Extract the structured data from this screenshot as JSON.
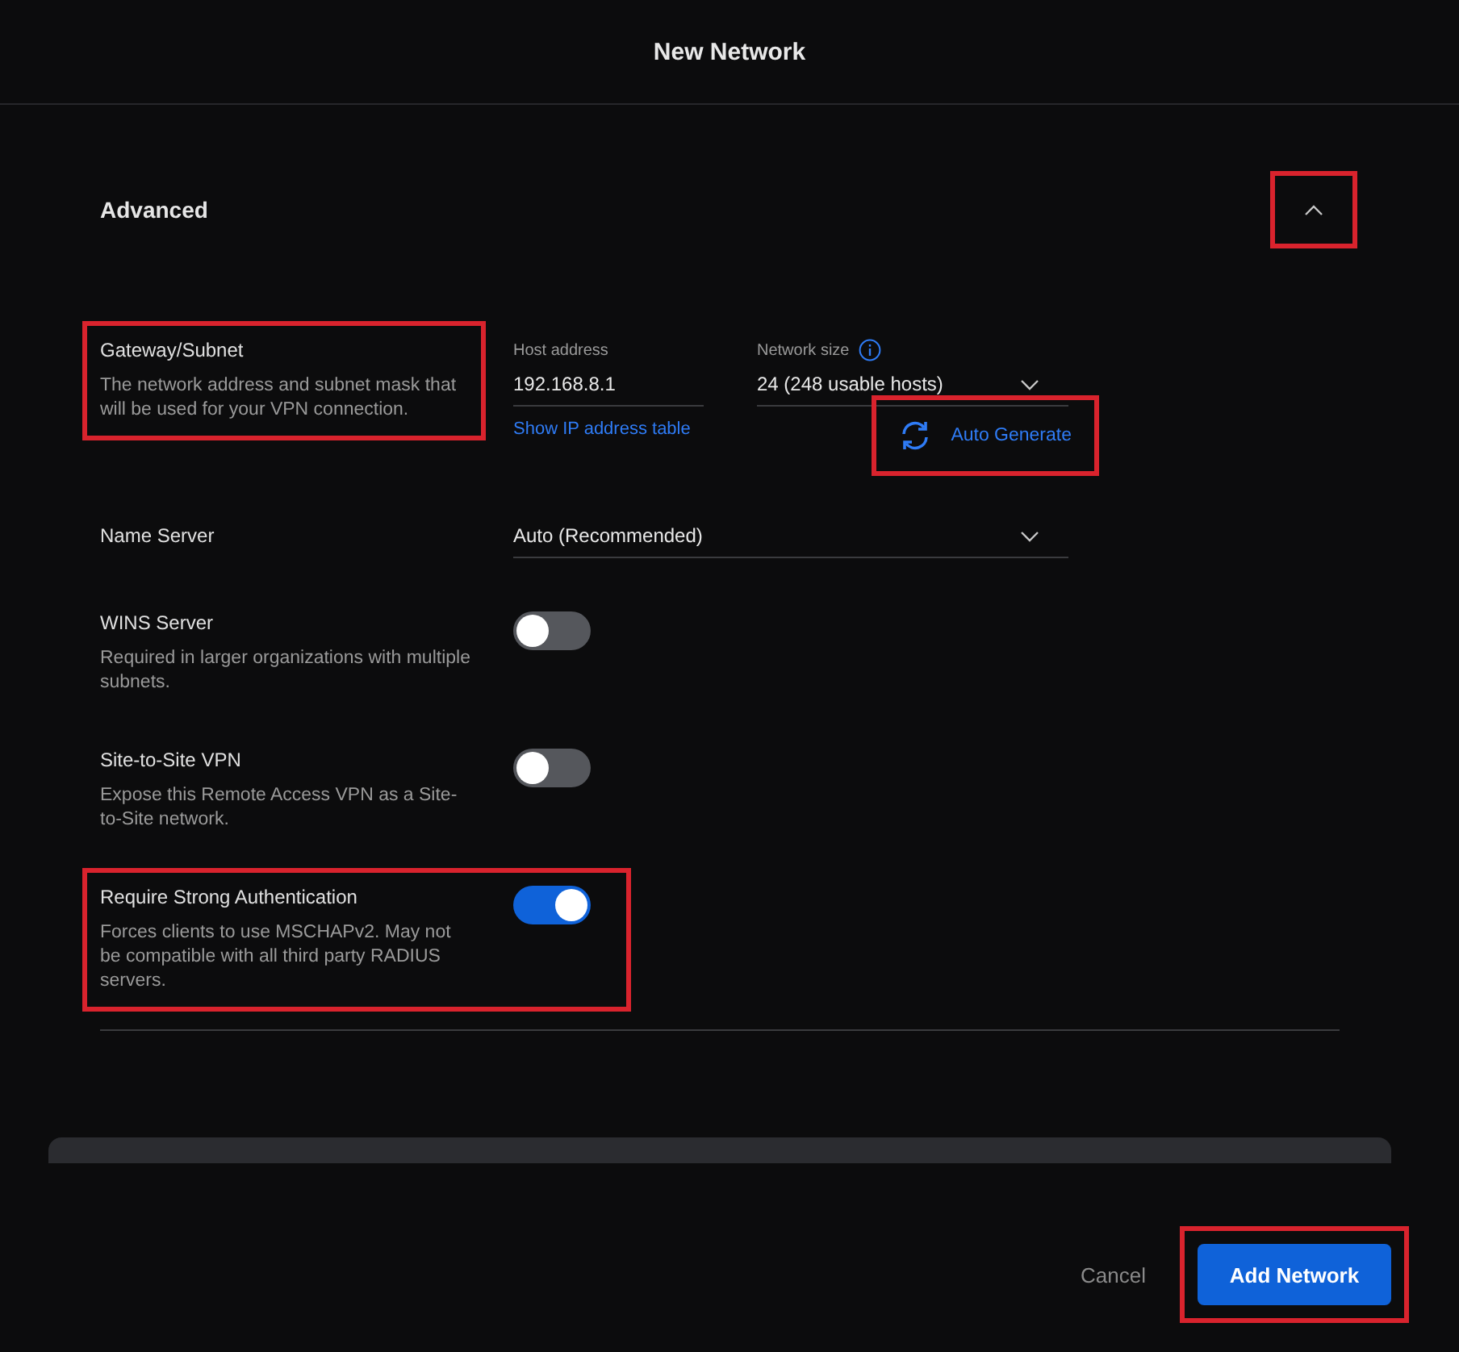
{
  "dialog": {
    "title": "New Network"
  },
  "section": {
    "title": "Advanced",
    "expanded": true,
    "highlighted": true
  },
  "settings": [
    {
      "kind": "subnet",
      "label": "Gateway/Subnet",
      "description": "The network address and subnet mask that will be used for your VPN connection.",
      "highlighted": true,
      "host_field": {
        "label": "Host address",
        "value": "192.168.8.1"
      },
      "link": "Show IP address table",
      "size_field": {
        "label": "Network size",
        "value": "24 (248 usable hosts)"
      },
      "generate_button": {
        "label": "Auto Generate",
        "highlighted": true
      }
    },
    {
      "kind": "select",
      "label": "Name Server",
      "value": "Auto (Recommended)",
      "highlighted": false
    },
    {
      "kind": "toggle",
      "label": "WINS Server",
      "description": "Required in larger organizations with multiple subnets.",
      "on": false,
      "highlighted": false
    },
    {
      "kind": "toggle",
      "label": "Site-to-Site VPN",
      "description": "Expose this Remote Access VPN as a Site-to-Site network.",
      "on": false,
      "highlighted": false
    },
    {
      "kind": "toggle",
      "label": "Require Strong Authentication",
      "description": "Forces clients to use MSCHAPv2. May not be compatible with all third party RADIUS servers.",
      "on": true,
      "highlighted": true
    }
  ],
  "footer": {
    "cancel": "Cancel",
    "submit": {
      "label": "Add Network",
      "highlighted": true
    }
  }
}
